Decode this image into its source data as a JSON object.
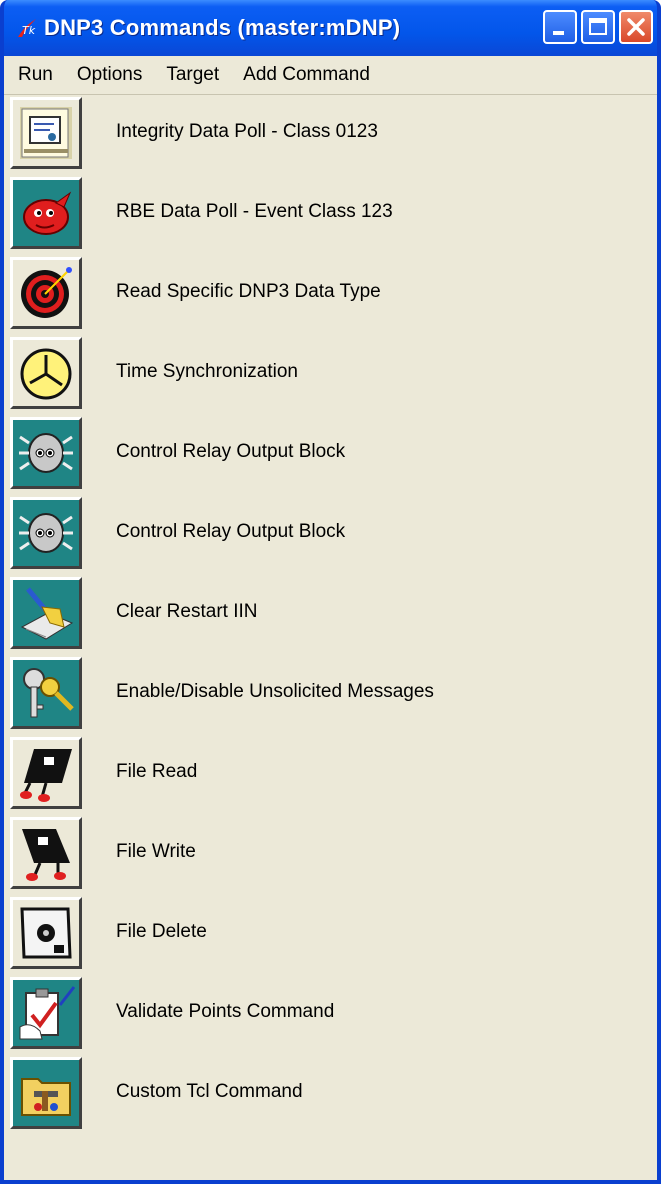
{
  "window": {
    "title": "DNP3 Commands (master:mDNP)",
    "title_bar_color": "#0a52e6",
    "close_button_color": "#e0502f"
  },
  "menu": {
    "items": [
      "Run",
      "Options",
      "Target",
      "Add Command"
    ]
  },
  "commands": [
    {
      "label": "Integrity Data Poll - Class 0123",
      "icon": "certificate-icon"
    },
    {
      "label": "RBE Data Poll - Event Class 123",
      "icon": "red-bird-icon"
    },
    {
      "label": "Read Specific DNP3 Data Type",
      "icon": "target-icon"
    },
    {
      "label": "Time Synchronization",
      "icon": "clock-icon"
    },
    {
      "label": "Control Relay Output Block",
      "icon": "bug-icon"
    },
    {
      "label": "Control Relay Output Block",
      "icon": "bug-icon"
    },
    {
      "label": "Clear Restart IIN",
      "icon": "broom-icon"
    },
    {
      "label": "Enable/Disable Unsolicited Messages",
      "icon": "keys-icon"
    },
    {
      "label": "File Read",
      "icon": "running-disk-icon"
    },
    {
      "label": "File Write",
      "icon": "running-disk-icon"
    },
    {
      "label": "File Delete",
      "icon": "floppy-disk-icon"
    },
    {
      "label": "Validate Points Command",
      "icon": "clipboard-check-icon"
    },
    {
      "label": "Custom Tcl Command",
      "icon": "toolbox-folder-icon"
    }
  ]
}
